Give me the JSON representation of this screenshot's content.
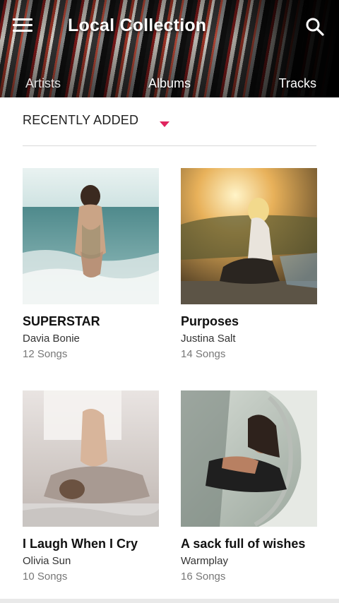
{
  "header": {
    "title": "Local Collection",
    "menu_icon": "menu-icon",
    "search_icon": "search-icon"
  },
  "tabs": [
    {
      "label": "Artists"
    },
    {
      "label": "Albums"
    },
    {
      "label": "Tracks"
    }
  ],
  "sort": {
    "label": "RECENTLY ADDED",
    "icon": "dropdown-caret-icon",
    "accent_color": "#e0245e"
  },
  "albums": [
    {
      "title": "SUPERSTAR",
      "artist": "Davia Bonie",
      "songs": "12 Songs"
    },
    {
      "title": "Purposes",
      "artist": "Justina Salt",
      "songs": "14 Songs"
    },
    {
      "title": "I Laugh When I Cry",
      "artist": "Olivia Sun",
      "songs": "10 Songs"
    },
    {
      "title": "A sack full of wishes",
      "artist": "Warmplay",
      "songs": "16 Songs"
    }
  ]
}
